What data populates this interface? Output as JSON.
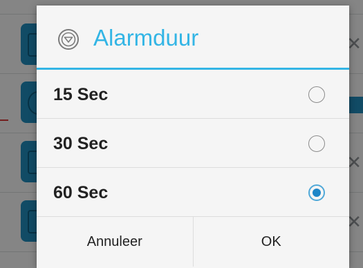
{
  "dialog": {
    "title": "Alarmduur",
    "icon": "chevron-down-circle-icon",
    "accent_color": "#33b5e5",
    "options": [
      {
        "label": "15 Sec",
        "selected": false
      },
      {
        "label": "30 Sec",
        "selected": false
      },
      {
        "label": "60 Sec",
        "selected": true
      }
    ],
    "buttons": {
      "cancel": "Annuleer",
      "ok": "OK"
    }
  }
}
